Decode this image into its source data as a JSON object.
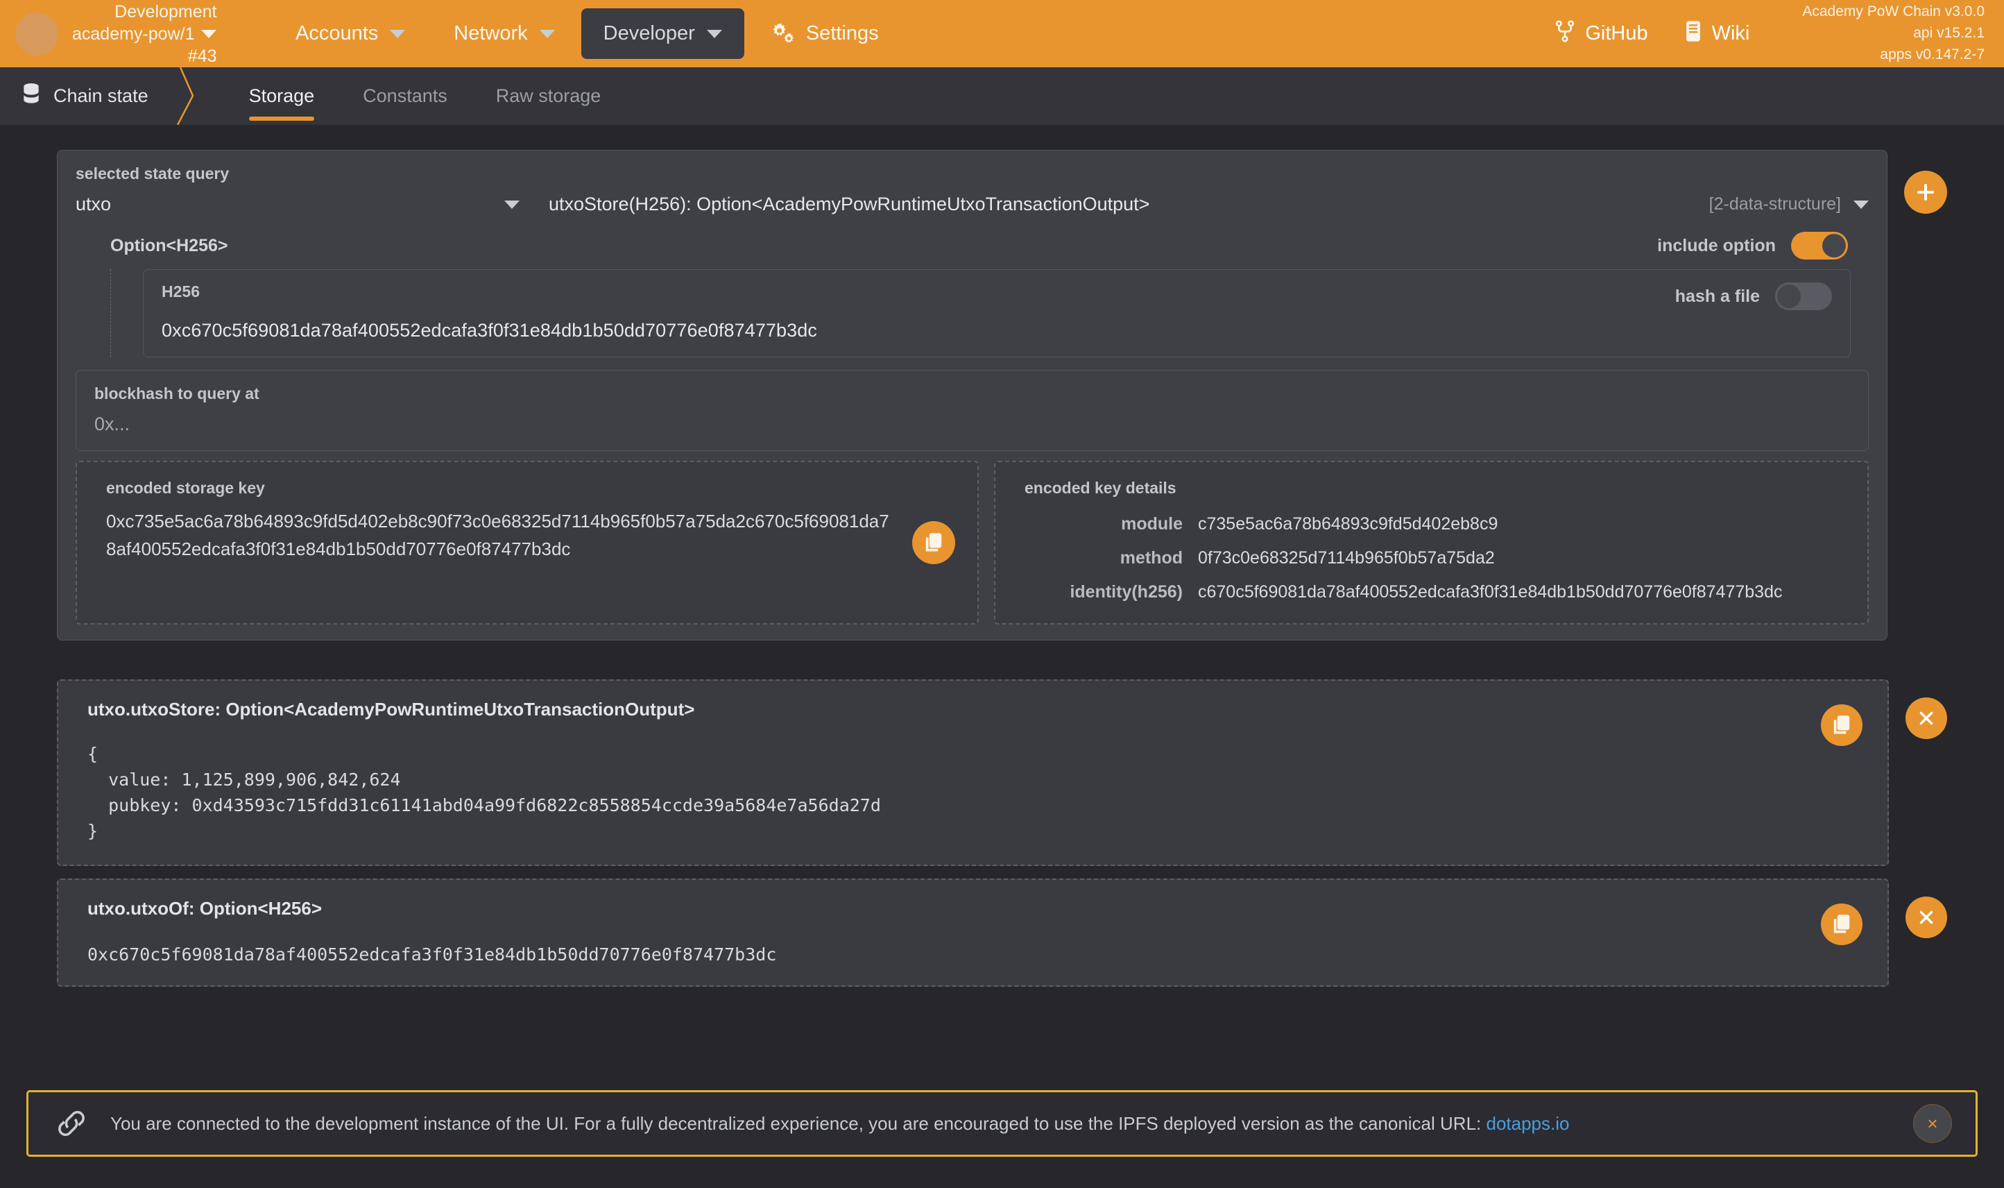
{
  "header": {
    "chain": {
      "network": "Development",
      "name": "academy-pow/1",
      "block": "#43"
    },
    "nav": [
      {
        "label": "Accounts",
        "icon": "chevron-down-icon",
        "active": false
      },
      {
        "label": "Network",
        "icon": "chevron-down-icon",
        "active": false
      },
      {
        "label": "Developer",
        "icon": "chevron-down-icon",
        "active": true
      },
      {
        "label": "Settings",
        "icon": "gears-icon",
        "active": false
      }
    ],
    "links": [
      {
        "label": "GitHub",
        "icon": "github-icon"
      },
      {
        "label": "Wiki",
        "icon": "book-icon"
      }
    ],
    "versions": {
      "chain": "Academy PoW Chain v3.0.0",
      "api": "api v15.2.1",
      "apps": "apps v0.147.2-7"
    }
  },
  "tabbar": {
    "breadcrumb": "Chain state",
    "breadcrumb_icon": "database-icon",
    "tabs": [
      {
        "label": "Storage",
        "active": true
      },
      {
        "label": "Constants",
        "active": false
      },
      {
        "label": "Raw storage",
        "active": false
      }
    ]
  },
  "query": {
    "label": "selected state query",
    "module": "utxo",
    "method": "utxoStore(H256): Option<AcademyPowRuntimeUtxoTransactionOutput>",
    "data_structure": "[2-data-structure]",
    "add_button": "add-query-button"
  },
  "params": {
    "title": "Option<H256>",
    "include_option": {
      "label": "include option",
      "state": "on"
    },
    "inner": {
      "title": "H256",
      "value": "0xc670c5f69081da78af400552edcafa3f0f31e84db1b50dd70776e0f87477b3dc",
      "hash_a_file": {
        "label": "hash a file",
        "state": "off"
      }
    }
  },
  "blockhash": {
    "label": "blockhash to query at",
    "placeholder": "0x..."
  },
  "encoded_key": {
    "label": "encoded storage key",
    "value": "0xc735e5ac6a78b64893c9fd5d402eb8c90f73c0e68325d7114b965f0b57a75da2c670c5f69081da78af400552edcafa3f0f31e84db1b50dd70776e0f87477b3dc"
  },
  "encoded_details": {
    "label": "encoded key details",
    "rows": [
      {
        "key": "module",
        "value": "c735e5ac6a78b64893c9fd5d402eb8c9"
      },
      {
        "key": "method",
        "value": "0f73c0e68325d7114b965f0b57a75da2"
      },
      {
        "key": "identity(h256)",
        "value": "c670c5f69081da78af400552edcafa3f0f31e84db1b50dd70776e0f87477b3dc"
      }
    ]
  },
  "results": [
    {
      "title": "utxo.utxoStore: Option<AcademyPowRuntimeUtxoTransactionOutput>",
      "body": "{\n  value: 1,125,899,906,842,624\n  pubkey: 0xd43593c715fdd31c61141abd04a99fd6822c8558854ccde39a5684e7a56da27d\n}"
    },
    {
      "title": "utxo.utxoOf: Option<H256>",
      "body": "0xc670c5f69081da78af400552edcafa3f0f31e84db1b50dd70776e0f87477b3dc"
    }
  ],
  "banner": {
    "icon": "link-icon",
    "text_before": "You are connected to the development instance of the UI. For a fully decentralized experience, you are encouraged to use the IPFS deployed version as the canonical URL: ",
    "link": "dotapps.io",
    "close": "×"
  },
  "colors": {
    "accent": "#e8952f",
    "page_bg": "#26262b",
    "panel_bg": "#3f3f46",
    "banner_border": "#e0b52c",
    "link": "#4a9fe0"
  }
}
